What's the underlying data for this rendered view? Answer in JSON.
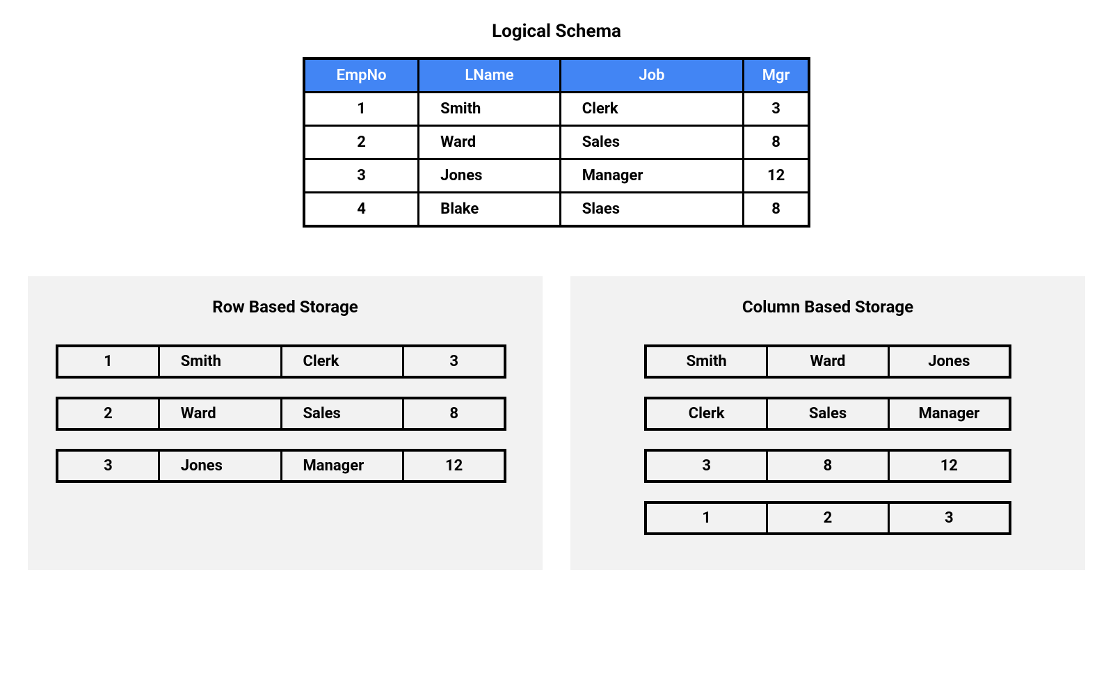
{
  "titles": {
    "logical": "Logical Schema",
    "row": "Row Based Storage",
    "col": "Column Based Storage"
  },
  "logical": {
    "headers": [
      "EmpNo",
      "LName",
      "Job",
      "Mgr"
    ],
    "rows": [
      {
        "empno": "1",
        "lname": "Smith",
        "job": "Clerk",
        "mgr": "3"
      },
      {
        "empno": "2",
        "lname": "Ward",
        "job": "Sales",
        "mgr": "8"
      },
      {
        "empno": "3",
        "lname": "Jones",
        "job": "Manager",
        "mgr": "12"
      },
      {
        "empno": "4",
        "lname": "Blake",
        "job": "Slaes",
        "mgr": "8"
      }
    ]
  },
  "row_storage": [
    [
      "1",
      "Smith",
      "Clerk",
      "3"
    ],
    [
      "2",
      "Ward",
      "Sales",
      "8"
    ],
    [
      "3",
      "Jones",
      "Manager",
      "12"
    ]
  ],
  "col_storage": [
    [
      "Smith",
      "Ward",
      "Jones"
    ],
    [
      "Clerk",
      "Sales",
      "Manager"
    ],
    [
      "3",
      "8",
      "12"
    ],
    [
      "1",
      "2",
      "3"
    ]
  ]
}
